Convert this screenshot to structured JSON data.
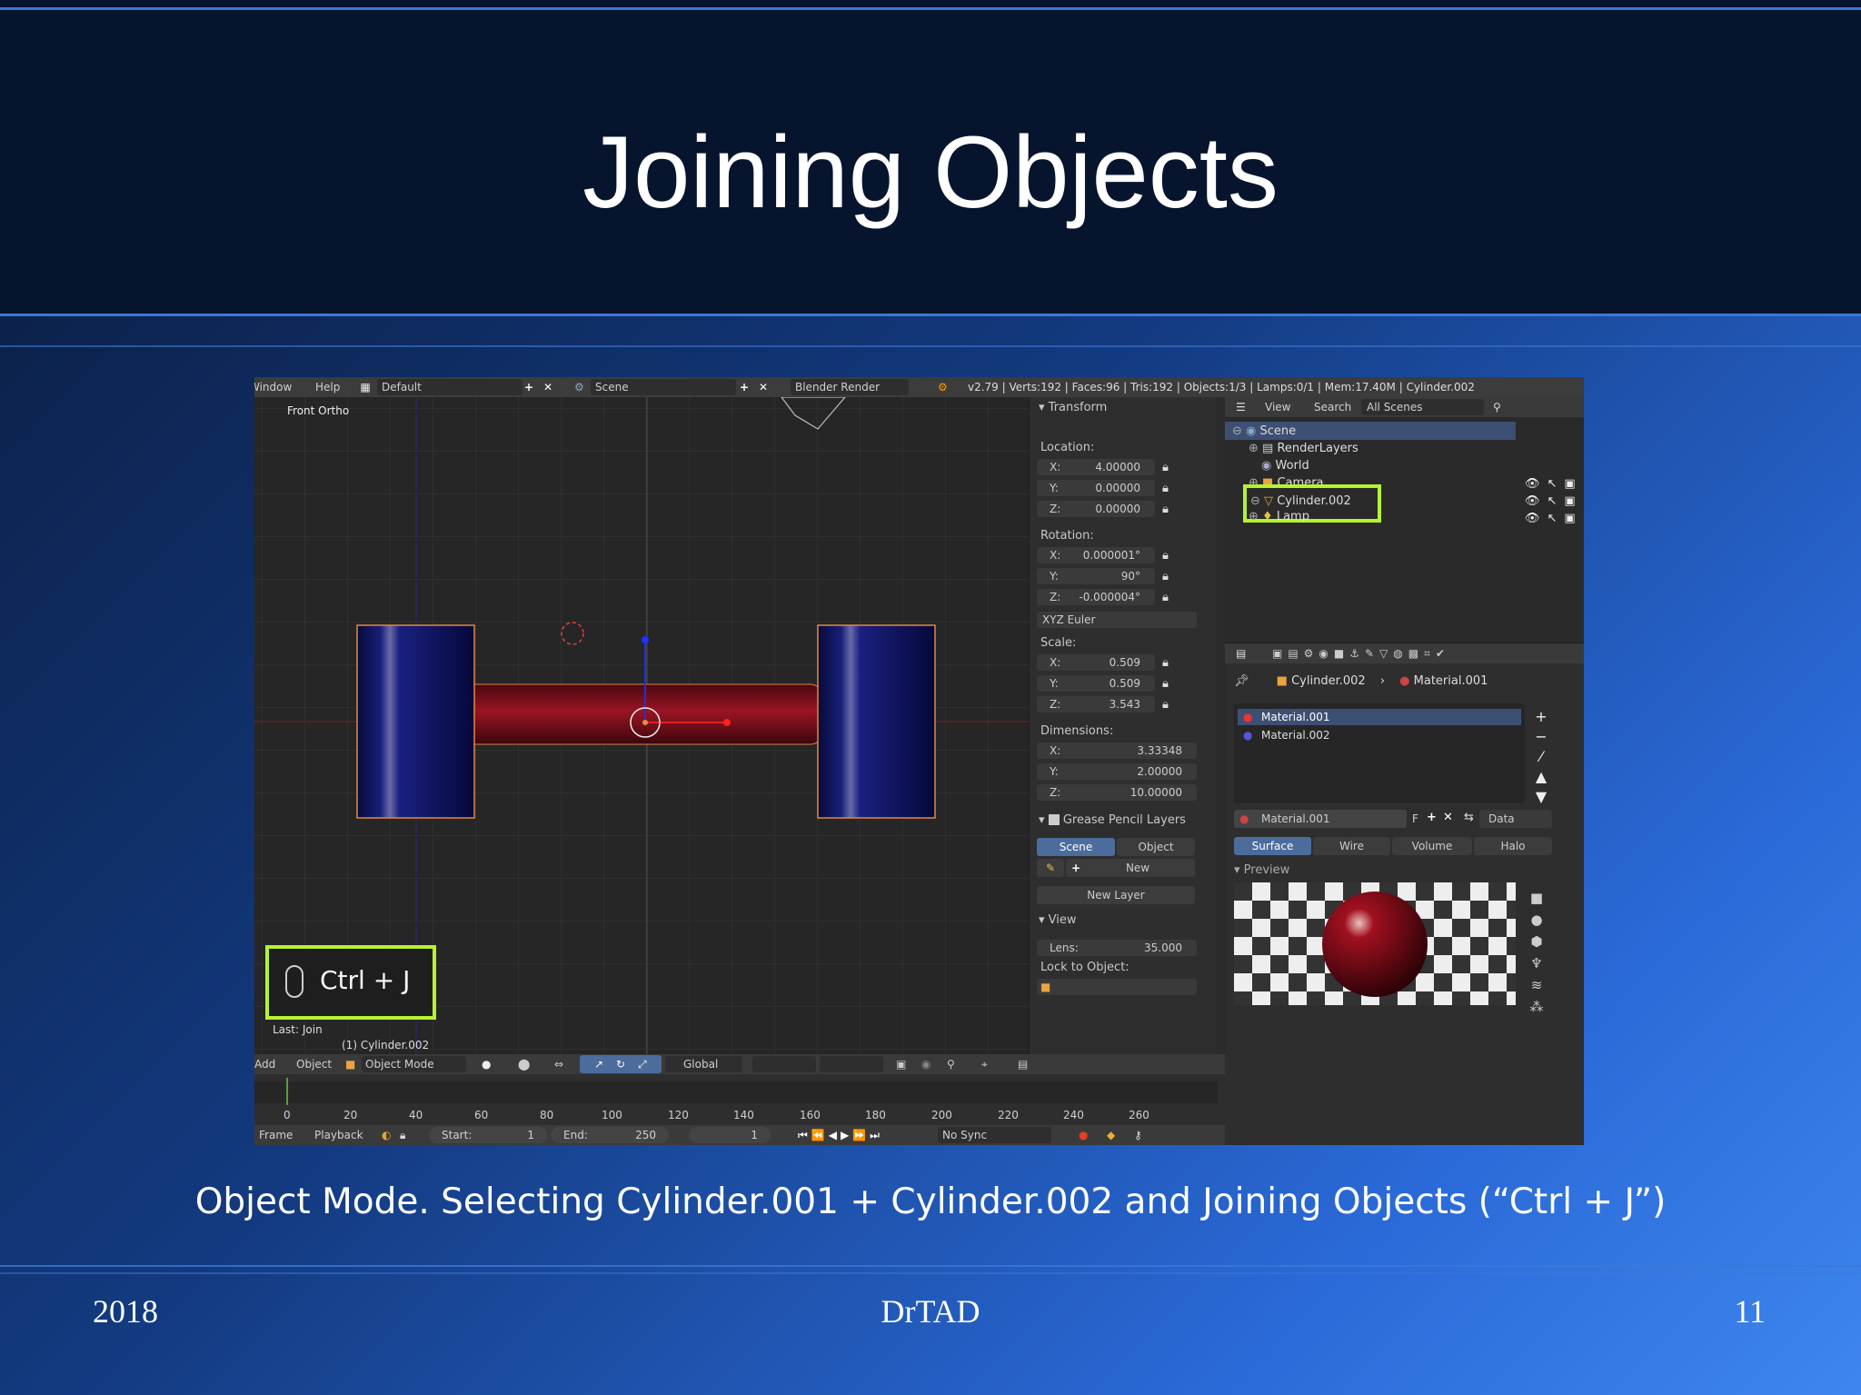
{
  "slide": {
    "title": "Joining Objects",
    "caption": "Object Mode. Selecting Cylinder.001 + Cylinder.002 and Joining Objects (“Ctrl + J”)",
    "year": "2018",
    "author": "DrTAD",
    "page": "11"
  },
  "topbar": {
    "window": "Window",
    "help": "Help",
    "layout": "Default",
    "scene": "Scene",
    "engine": "Blender Render",
    "stats": "v2.79 | Verts:192 | Faces:96 | Tris:192 | Objects:1/3 | Lamps:0/1 | Mem:17.40M | Cylinder.002"
  },
  "viewport": {
    "view_label": "Front Ortho",
    "shortcut": "Ctrl + J",
    "last_op": "Last: Join",
    "object_label": "(1) Cylinder.002"
  },
  "viewport_header": {
    "add": "Add",
    "object": "Object",
    "mode": "Object Mode",
    "orientation": "Global"
  },
  "transform": {
    "title": "Transform",
    "location_label": "Location:",
    "location": [
      {
        "axis": "X:",
        "value": "4.00000"
      },
      {
        "axis": "Y:",
        "value": "0.00000"
      },
      {
        "axis": "Z:",
        "value": "0.00000"
      }
    ],
    "rotation_label": "Rotation:",
    "rotation": [
      {
        "axis": "X:",
        "value": "0.000001°"
      },
      {
        "axis": "Y:",
        "value": "90°"
      },
      {
        "axis": "Z:",
        "value": "-0.000004°"
      }
    ],
    "rotation_mode": "XYZ Euler",
    "scale_label": "Scale:",
    "scale": [
      {
        "axis": "X:",
        "value": "0.509"
      },
      {
        "axis": "Y:",
        "value": "0.509"
      },
      {
        "axis": "Z:",
        "value": "3.543"
      }
    ],
    "dimensions_label": "Dimensions:",
    "dimensions": [
      {
        "axis": "X:",
        "value": "3.33348"
      },
      {
        "axis": "Y:",
        "value": "2.00000"
      },
      {
        "axis": "Z:",
        "value": "10.00000"
      }
    ],
    "grease_title": "Grease Pencil Layers",
    "gp_scene": "Scene",
    "gp_object": "Object",
    "gp_new": "New",
    "gp_new_layer": "New Layer",
    "view_title": "View",
    "lens_label": "Lens:",
    "lens_value": "35.000",
    "lock_label": "Lock to Object:"
  },
  "outliner": {
    "view": "View",
    "search": "Search",
    "filter": "All Scenes",
    "items": [
      "Scene",
      "RenderLayers",
      "World",
      "Camera",
      "Cylinder.002",
      "Lamp"
    ]
  },
  "properties": {
    "breadcrumb_obj": "Cylinder.002",
    "breadcrumb_mat": "Material.001",
    "materials": [
      "Material.001",
      "Material.002"
    ],
    "material_field": "Material.001",
    "f_label": "F",
    "data": "Data",
    "tabs": [
      "Surface",
      "Wire",
      "Volume",
      "Halo"
    ],
    "preview": "Preview"
  },
  "timeline": {
    "ticks": [
      "0",
      "20",
      "40",
      "60",
      "80",
      "100",
      "120",
      "140",
      "160",
      "180",
      "200",
      "220",
      "240",
      "260"
    ],
    "frame": "Frame",
    "playback": "Playback",
    "start_label": "Start:",
    "start": "1",
    "end_label": "End:",
    "end": "250",
    "current": "1",
    "sync": "No Sync"
  },
  "colors": {
    "highlight": "#b6f233",
    "cyl_end": "#0c0f55",
    "cyl_mid": "#8a1020"
  }
}
